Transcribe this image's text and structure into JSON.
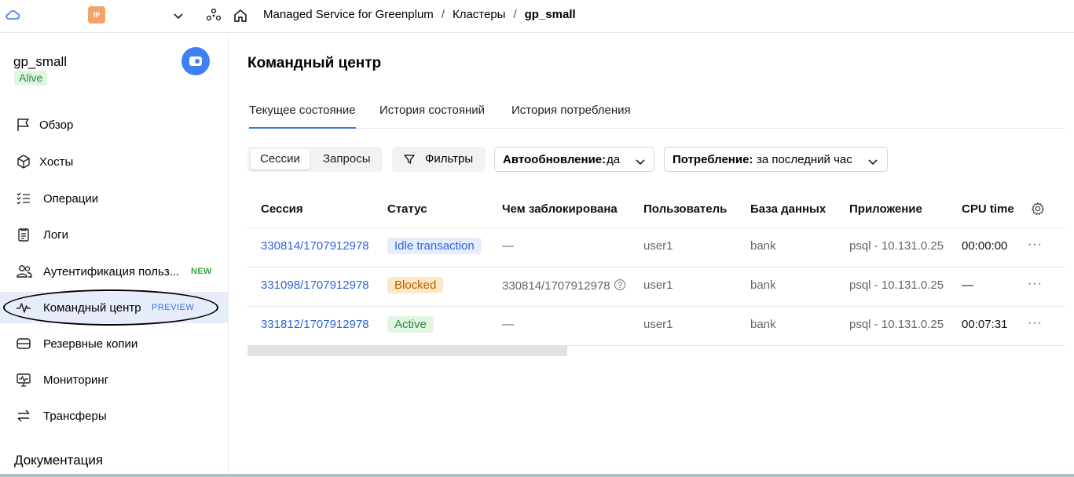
{
  "topbar": {
    "ip_badge": "IP",
    "breadcrumb": [
      "Managed Service for Greenplum",
      "Кластеры",
      "gp_small"
    ]
  },
  "sidebar": {
    "cluster_name": "gp_small",
    "cluster_status": "Alive",
    "items": [
      {
        "label": "Обзор",
        "icon": "flag-icon"
      },
      {
        "label": "Хосты",
        "icon": "cube-icon"
      },
      {
        "label": "Операции",
        "icon": "list-check-icon"
      },
      {
        "label": "Логи",
        "icon": "document-icon"
      },
      {
        "label": "Аутентификация польз...",
        "icon": "users-icon",
        "tag": "NEW"
      },
      {
        "label": "Командный центр",
        "icon": "pulse-icon",
        "tag": "PREVIEW",
        "active": true
      },
      {
        "label": "Резервные копии",
        "icon": "disk-icon"
      },
      {
        "label": "Мониторинг",
        "icon": "monitor-icon"
      },
      {
        "label": "Трансферы",
        "icon": "arrows-icon"
      }
    ],
    "docs_label": "Документация"
  },
  "main": {
    "title": "Командный центр",
    "tabs": [
      "Текущее состояние",
      "История состояний",
      "История потребления"
    ],
    "segments": [
      "Сессии",
      "Запросы"
    ],
    "filters_label": "Фильтры",
    "autorefresh": {
      "key": "Автообновление:",
      "value": "да"
    },
    "consumption": {
      "key": "Потребление:",
      "value": "за последний час"
    }
  },
  "table": {
    "columns": [
      "Сессия",
      "Статус",
      "Чем заблокирована",
      "Пользователь",
      "База данных",
      "Приложение",
      "CPU time"
    ],
    "rows": [
      {
        "session": "330814/1707912978",
        "status": "Idle transaction",
        "status_kind": "idle",
        "blocked_by": "—",
        "user": "user1",
        "db": "bank",
        "app": "psql - 10.131.0.25",
        "cpu": "00:00:00"
      },
      {
        "session": "331098/1707912978",
        "status": "Blocked",
        "status_kind": "blocked",
        "blocked_by": "330814/1707912978",
        "user": "user1",
        "db": "bank",
        "app": "psql - 10.131.0.25",
        "cpu": "—"
      },
      {
        "session": "331812/1707912978",
        "status": "Active",
        "status_kind": "active",
        "blocked_by": "—",
        "user": "user1",
        "db": "bank",
        "app": "psql - 10.131.0.25",
        "cpu": "00:07:31"
      }
    ],
    "row_menu": "···"
  },
  "colors": {
    "accent": "#3a72e8",
    "link": "#2f63d8",
    "active_bg": "#e7ecfb"
  }
}
